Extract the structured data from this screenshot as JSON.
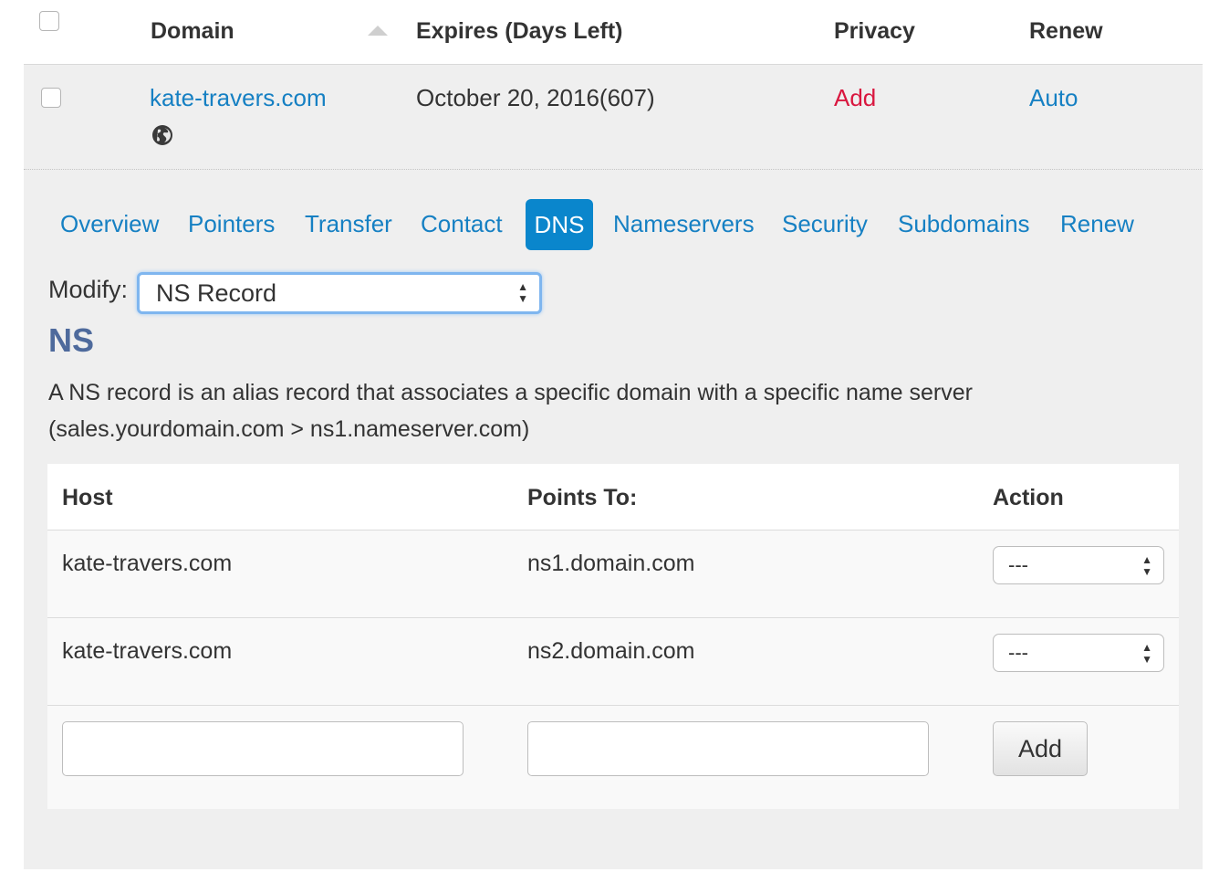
{
  "header": {
    "domain": "Domain",
    "expires": "Expires (Days Left)",
    "privacy": "Privacy",
    "renew": "Renew"
  },
  "domain_row": {
    "domain": "kate-travers.com",
    "expires": "October 20, 2016(607)",
    "privacy": "Add",
    "renew": "Auto"
  },
  "tabs": [
    "Overview",
    "Pointers",
    "Transfer",
    "Contact",
    "DNS",
    "Nameservers",
    "Security",
    "Subdomains",
    "Renew"
  ],
  "active_tab": "DNS",
  "modify": {
    "label": "Modify:",
    "selected": "NS Record"
  },
  "section": {
    "heading": "NS",
    "description": "A NS record is an alias record that associates a specific domain with a specific name server (sales.yourdomain.com > ns1.nameserver.com)"
  },
  "table": {
    "headers": {
      "host": "Host",
      "points_to": "Points To:",
      "action": "Action"
    },
    "rows": [
      {
        "host": "kate-travers.com",
        "points_to": "ns1.domain.com",
        "action": "---"
      },
      {
        "host": "kate-travers.com",
        "points_to": "ns2.domain.com",
        "action": "---"
      }
    ],
    "add_label": "Add"
  },
  "colors": {
    "link": "#1680c3",
    "privacy_add": "#d9173f",
    "active_tab_bg": "#0a86cc",
    "heading": "#4e6a9c",
    "panel_bg": "#efefef"
  }
}
